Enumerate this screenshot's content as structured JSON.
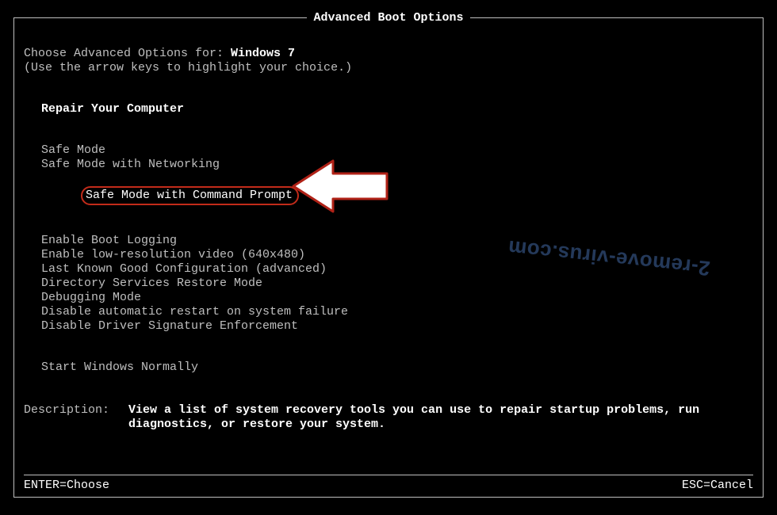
{
  "title": "Advanced Boot Options",
  "choose_prefix": "Choose Advanced Options for: ",
  "os_name": "Windows 7",
  "hint": "(Use the arrow keys to highlight your choice.)",
  "repair": "Repair Your Computer",
  "menu": {
    "safe_mode": "Safe Mode",
    "safe_mode_net": "Safe Mode with Networking",
    "safe_mode_cmd": "Safe Mode with Command Prompt",
    "boot_logging": "Enable Boot Logging",
    "low_res": "Enable low-resolution video (640x480)",
    "lkgc": "Last Known Good Configuration (advanced)",
    "dsrm": "Directory Services Restore Mode",
    "debug": "Debugging Mode",
    "no_auto_restart": "Disable automatic restart on system failure",
    "no_driver_sig": "Disable Driver Signature Enforcement",
    "start_normal": "Start Windows Normally"
  },
  "desc_label": "Description:",
  "desc_text": "View a list of system recovery tools you can use to repair startup problems, run diagnostics, or restore your system.",
  "footer": {
    "enter": "ENTER=Choose",
    "esc": "ESC=Cancel"
  },
  "watermark": "2-remove-virus.com"
}
